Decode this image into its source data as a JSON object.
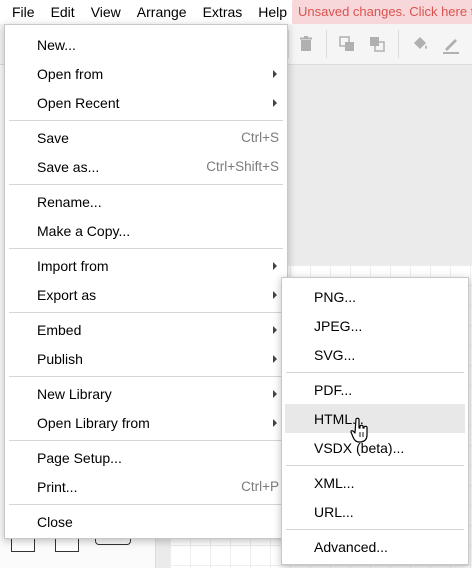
{
  "menubar": {
    "items": [
      "File",
      "Edit",
      "View",
      "Arrange",
      "Extras",
      "Help"
    ],
    "unsaved_text": "Unsaved changes. Click here to save."
  },
  "toolbar": {
    "icons": [
      "trash-icon",
      "to-front-icon",
      "to-back-icon",
      "fill-color-icon",
      "line-color-icon"
    ]
  },
  "file_menu": {
    "items": {
      "new": "New...",
      "open_from": "Open from",
      "open_recent": "Open Recent",
      "save": "Save",
      "save_shortcut": "Ctrl+S",
      "save_as": "Save as...",
      "save_as_shortcut": "Ctrl+Shift+S",
      "rename": "Rename...",
      "make_copy": "Make a Copy...",
      "import_from": "Import from",
      "export_as": "Export as",
      "embed": "Embed",
      "publish": "Publish",
      "new_library": "New Library",
      "open_library_from": "Open Library from",
      "page_setup": "Page Setup...",
      "print": "Print...",
      "print_shortcut": "Ctrl+P",
      "close": "Close"
    }
  },
  "export_menu": {
    "highlighted": "HTML...",
    "items": {
      "png": "PNG...",
      "jpeg": "JPEG...",
      "svg": "SVG...",
      "pdf": "PDF...",
      "html": "HTML...",
      "vsdx": "VSDX (beta)...",
      "xml": "XML...",
      "url": "URL...",
      "advanced": "Advanced..."
    }
  },
  "colors": {
    "unsaved_bg": "#f8d7da",
    "unsaved_text": "#d9534f",
    "highlight": "#e8e8e8",
    "shortcut_text": "#7b7b7b"
  }
}
